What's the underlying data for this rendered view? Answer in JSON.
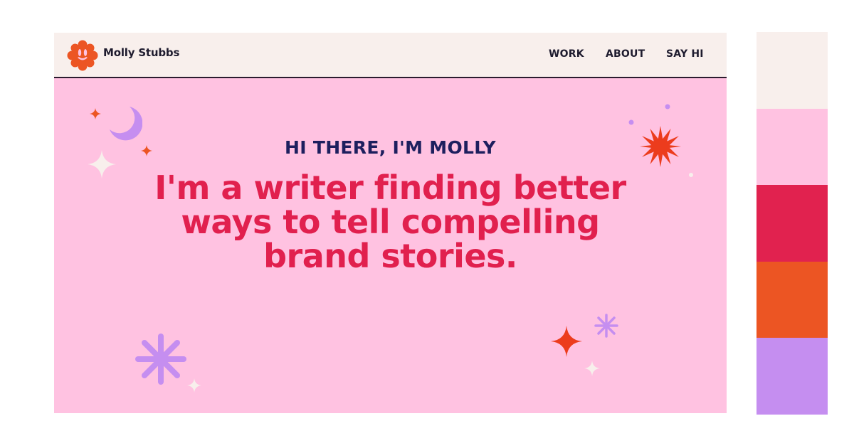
{
  "site": {
    "brand_name": "Molly Stubbs",
    "nav": [
      {
        "label": "WORK"
      },
      {
        "label": "ABOUT"
      },
      {
        "label": "SAY HI"
      }
    ]
  },
  "hero": {
    "greeting": "HI THERE, I'M MOLLY",
    "headline": "I'm a writer finding better ways to tell compelling brand stories."
  },
  "palette": [
    "#f8efec",
    "#ffc2e1",
    "#e1224f",
    "#ec5523",
    "#c58ef0"
  ],
  "icons": [
    "logo-flower-icon",
    "moon-icon",
    "sparkle-icon",
    "starburst-icon",
    "asterisk-icon",
    "dot-icon"
  ]
}
